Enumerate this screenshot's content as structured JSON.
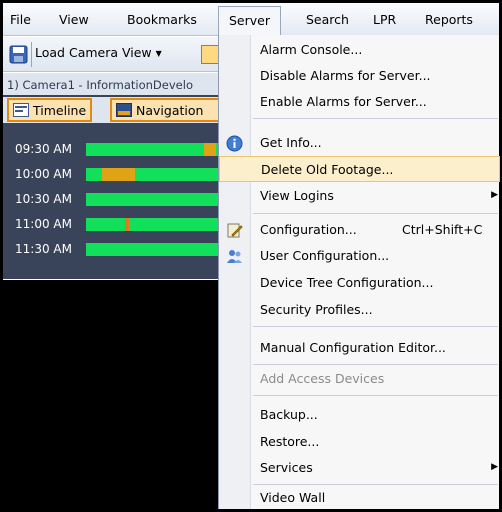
{
  "menubar": {
    "items": [
      {
        "label": "File"
      },
      {
        "label": "View"
      },
      {
        "label": "Bookmarks"
      },
      {
        "label": "Server"
      },
      {
        "label": "Search"
      },
      {
        "label": "LPR"
      },
      {
        "label": "Reports"
      }
    ]
  },
  "toolbar": {
    "load_camera_view_label": "Load Camera View"
  },
  "camera": {
    "title": "1) Camera1 - InformationDevelo",
    "tabs": [
      {
        "label": "Timeline"
      },
      {
        "label": "Navigation"
      }
    ],
    "timeline_rows": [
      {
        "time": "09:30 AM"
      },
      {
        "time": "10:00 AM"
      },
      {
        "time": "10:30 AM"
      },
      {
        "time": "11:00 AM"
      },
      {
        "time": "11:30 AM"
      }
    ]
  },
  "server_menu": {
    "items": [
      {
        "label": "Alarm Console..."
      },
      {
        "label": "Disable Alarms for Server..."
      },
      {
        "label": "Enable Alarms for Server..."
      },
      {
        "label": "Get Info..."
      },
      {
        "label": "Delete Old Footage..."
      },
      {
        "label": "View Logins"
      },
      {
        "label": "Configuration...",
        "shortcut": "Ctrl+Shift+C"
      },
      {
        "label": "User Configuration..."
      },
      {
        "label": "Device Tree Configuration..."
      },
      {
        "label": "Security Profiles..."
      },
      {
        "label": "Manual Configuration Editor..."
      },
      {
        "label": "Add Access Devices"
      },
      {
        "label": "Backup..."
      },
      {
        "label": "Restore..."
      },
      {
        "label": "Services"
      },
      {
        "label": "Video Wall"
      }
    ]
  },
  "colors": {
    "highlight": "#fcefcc",
    "timeline_green": "#12e05a",
    "timeline_orange": "#e0a316",
    "panel_bg": "#39435a"
  }
}
